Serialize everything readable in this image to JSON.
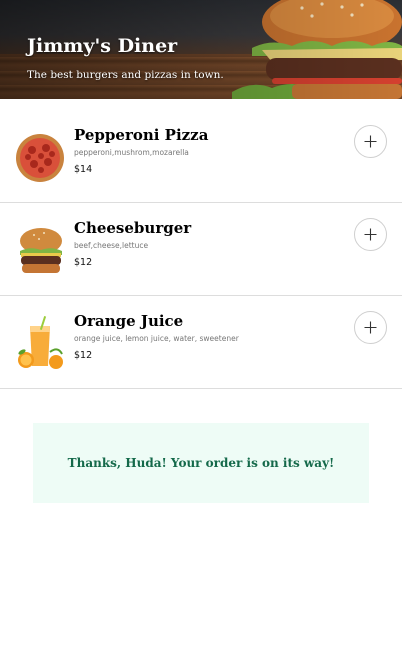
{
  "hero": {
    "title": "Jimmy's Diner",
    "subtitle": "The best burgers and pizzas in town."
  },
  "menu": {
    "items": [
      {
        "name": "Pepperoni Pizza",
        "description": "pepperoni,mushrom,mozarella",
        "price": "$14",
        "icon": "pizza-icon"
      },
      {
        "name": "Cheeseburger",
        "description": "beef,cheese,lettuce",
        "price": "$12",
        "icon": "burger-icon"
      },
      {
        "name": "Orange Juice",
        "description": "orange juice, lemon juice, water, sweetener",
        "price": "$12",
        "icon": "juice-icon"
      }
    ],
    "add_icon": "plus-icon"
  },
  "confirmation": {
    "message": "Thanks, Huda! Your order is on its way!"
  },
  "colors": {
    "confirm_background": "#eefcf6",
    "confirm_text": "#14694a",
    "divider": "#dddddd"
  }
}
